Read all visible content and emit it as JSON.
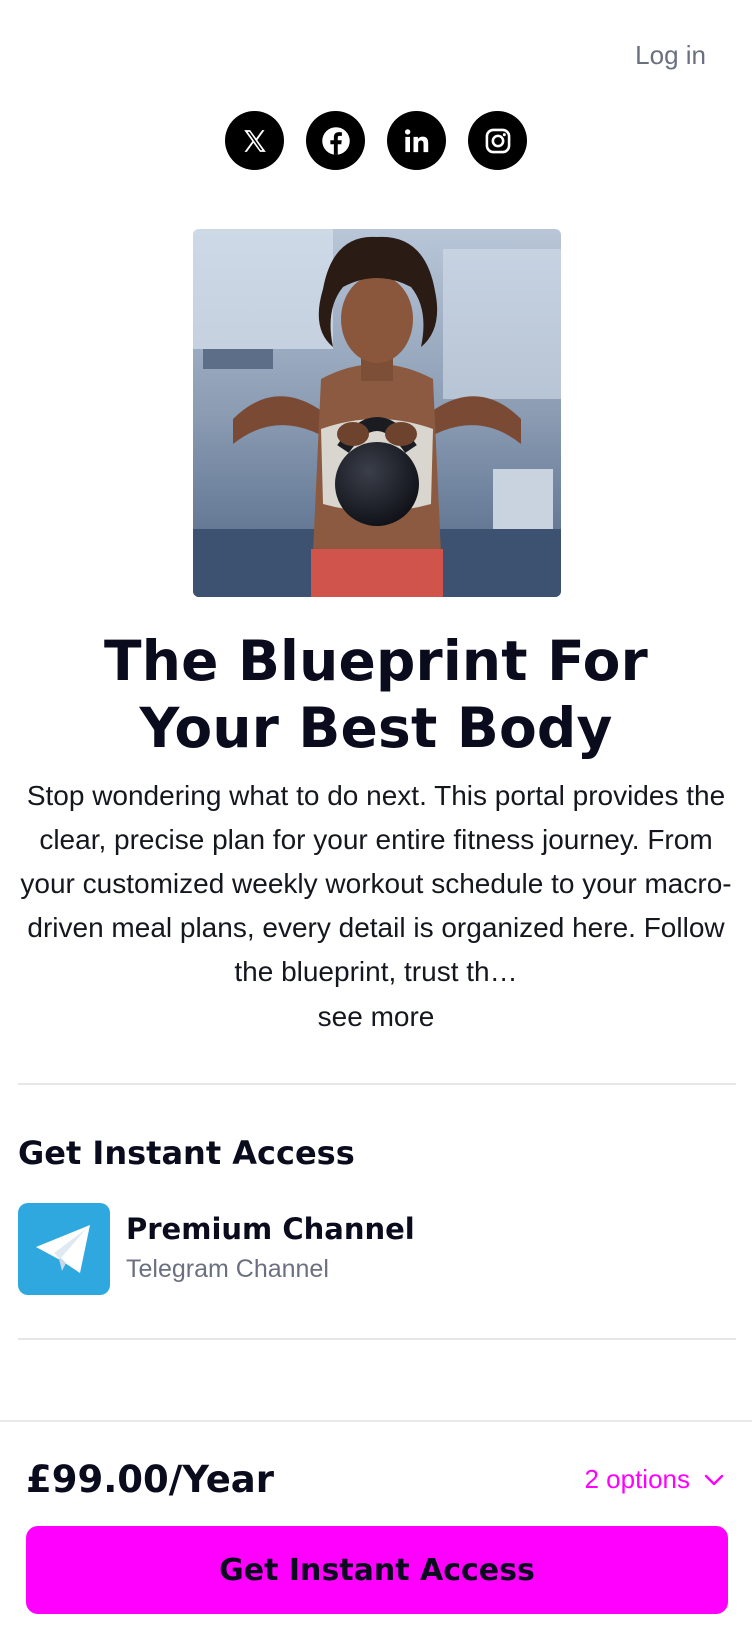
{
  "header": {
    "login_label": "Log in"
  },
  "social_links": [
    {
      "icon": "x-icon"
    },
    {
      "icon": "facebook-icon"
    },
    {
      "icon": "linkedin-icon"
    },
    {
      "icon": "instagram-icon"
    }
  ],
  "hero": {
    "image": "woman-holding-kettlebell-photo"
  },
  "product_page": {
    "title": "The Blueprint For Your Best Body",
    "description": "Stop wondering what to do next. This portal provides the clear, precise plan for your entire fitness journey. From your customized weekly workout schedule to your macro-driven meal plans, every detail is organized here. Follow the blueprint, trust th…",
    "see_more_label": "see more"
  },
  "access": {
    "heading": "Get Instant Access",
    "items": [
      {
        "name": "Premium Channel",
        "type": "Telegram Channel",
        "icon": "telegram-icon"
      }
    ]
  },
  "footer": {
    "price": "£99.00/Year",
    "options_label": "2 options",
    "cta_label": "Get Instant Access"
  },
  "colors": {
    "accent": "#ff00ff",
    "telegram": "#2fa8e0",
    "text_primary": "#0a0c1e",
    "text_muted": "#6b7080"
  }
}
